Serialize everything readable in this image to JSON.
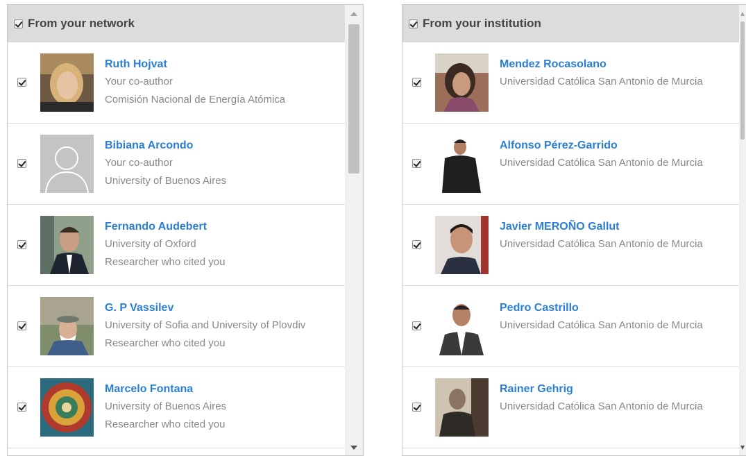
{
  "left_panel": {
    "title": "From your network",
    "people": [
      {
        "name": "Ruth Hojvat",
        "line1": "Your co-author",
        "line2": "Comisión Nacional de Energía Atómica"
      },
      {
        "name": "Bibiana Arcondo",
        "line1": "Your co-author",
        "line2": "University of Buenos Aires"
      },
      {
        "name": "Fernando Audebert",
        "line1": "University of Oxford",
        "line2": "Researcher who cited you"
      },
      {
        "name": "G. P Vassilev",
        "line1": "University of Sofia and University of Plovdiv",
        "line2": "Researcher who cited you"
      },
      {
        "name": "Marcelo Fontana",
        "line1": "University of Buenos Aires",
        "line2": "Researcher who cited you"
      }
    ]
  },
  "right_panel": {
    "title": "From your institution",
    "people": [
      {
        "name": "Mendez Rocasolano",
        "line1": "Universidad Católica San Antonio de Murcia"
      },
      {
        "name": "Alfonso Pérez-Garrido",
        "line1": "Universidad Católica San Antonio de Murcia"
      },
      {
        "name": "Javier MEROÑO Gallut",
        "line1": "Universidad Católica San Antonio de Murcia"
      },
      {
        "name": "Pedro Castrillo",
        "line1": "Universidad Católica San Antonio de Murcia"
      },
      {
        "name": "Rainer Gehrig",
        "line1": "Universidad Católica San Antonio de Murcia"
      }
    ]
  },
  "colors": {
    "name_link": "#2a7fd4",
    "secondary_text": "#888888",
    "header_bg": "#dcdcdc"
  }
}
